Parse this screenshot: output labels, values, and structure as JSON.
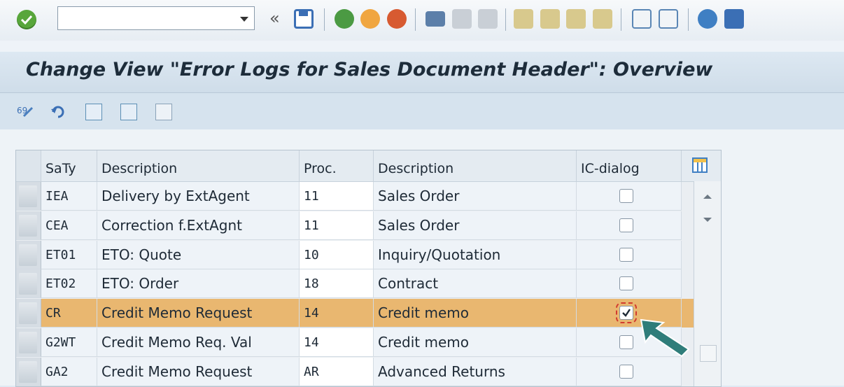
{
  "toolbar": {
    "command_field_value": "",
    "nav_back_glyph": "«",
    "icons": [
      "check-icon",
      "save-icon",
      "back-icon",
      "exit-icon",
      "cancel-icon",
      "print-icon",
      "find-icon",
      "find-next-icon",
      "first-page-icon",
      "previous-page-icon",
      "next-page-icon",
      "last-page-icon",
      "create-session-icon",
      "shortcut-icon",
      "help-icon",
      "customize-layout-icon"
    ]
  },
  "title": "Change View \"Error Logs for Sales Document Header\": Overview",
  "app_toolbar": {
    "icons": [
      "display-change-icon",
      "undo-icon",
      "select-all-icon",
      "select-block-icon",
      "deselect-all-icon"
    ]
  },
  "table": {
    "columns": [
      "SaTy",
      "Description",
      "Proc.",
      "Description",
      "IC-dialog"
    ],
    "rows": [
      {
        "saty": "IEA",
        "desc": "Delivery by ExtAgent",
        "proc": "11",
        "proc_desc": "Sales Order",
        "ic_dialog": false,
        "selected": false
      },
      {
        "saty": "CEA",
        "desc": "Correction f.ExtAgnt",
        "proc": "11",
        "proc_desc": "Sales Order",
        "ic_dialog": false,
        "selected": false
      },
      {
        "saty": "ET01",
        "desc": "ETO: Quote",
        "proc": "10",
        "proc_desc": "Inquiry/Quotation",
        "ic_dialog": false,
        "selected": false
      },
      {
        "saty": "ET02",
        "desc": "ETO: Order",
        "proc": "18",
        "proc_desc": "Contract",
        "ic_dialog": false,
        "selected": false
      },
      {
        "saty": "CR",
        "desc": "Credit Memo Request",
        "proc": "14",
        "proc_desc": "Credit memo",
        "ic_dialog": true,
        "selected": true
      },
      {
        "saty": "G2WT",
        "desc": "Credit Memo Req. Val",
        "proc": "14",
        "proc_desc": "Credit memo",
        "ic_dialog": false,
        "selected": false
      },
      {
        "saty": "GA2",
        "desc": "Credit Memo Request",
        "proc": "AR",
        "proc_desc": "Advanced Returns",
        "ic_dialog": false,
        "selected": false
      }
    ]
  },
  "colors": {
    "highlight_row": "#e9b770",
    "accent_arrow": "#2f7d7a"
  }
}
